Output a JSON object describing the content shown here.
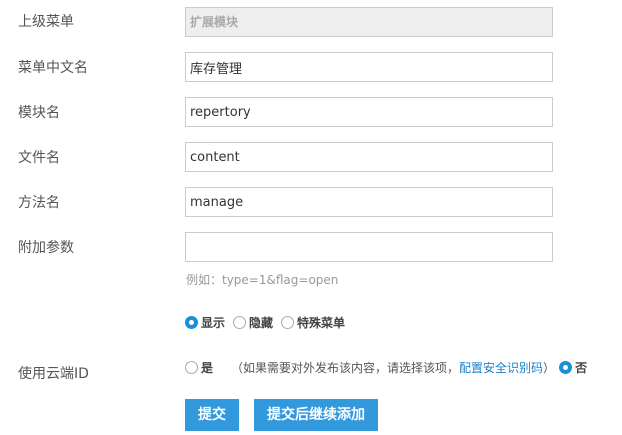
{
  "form": {
    "parent_menu": {
      "label": "上级菜单",
      "value": "扩展模块"
    },
    "menu_name_cn": {
      "label": "菜单中文名",
      "value": "库存管理"
    },
    "module_name": {
      "label": "模块名",
      "value": "repertory"
    },
    "file_name": {
      "label": "文件名",
      "value": "content"
    },
    "method_name": {
      "label": "方法名",
      "value": "manage"
    },
    "extra_params": {
      "label": "附加参数",
      "value": "",
      "hint": "例如：type=1&flag=open"
    },
    "display": {
      "options": [
        {
          "label": "显示",
          "checked": true
        },
        {
          "label": "隐藏",
          "checked": false
        },
        {
          "label": "特殊菜单",
          "checked": false
        }
      ]
    },
    "cloud_id": {
      "label": "使用云端ID",
      "yes_label": "是",
      "yes_checked": false,
      "note_prefix": "（如果需要对外发布该内容，请选择该项，",
      "note_link": "配置安全识别码",
      "note_suffix": "）",
      "no_label": "否",
      "no_checked": true
    }
  },
  "buttons": {
    "submit": "提交",
    "submit_continue": "提交后继续添加"
  },
  "colors": {
    "accent": "#3399dd",
    "link": "#1a7fc8",
    "label_text": "#555555",
    "hint_text": "#999999"
  }
}
